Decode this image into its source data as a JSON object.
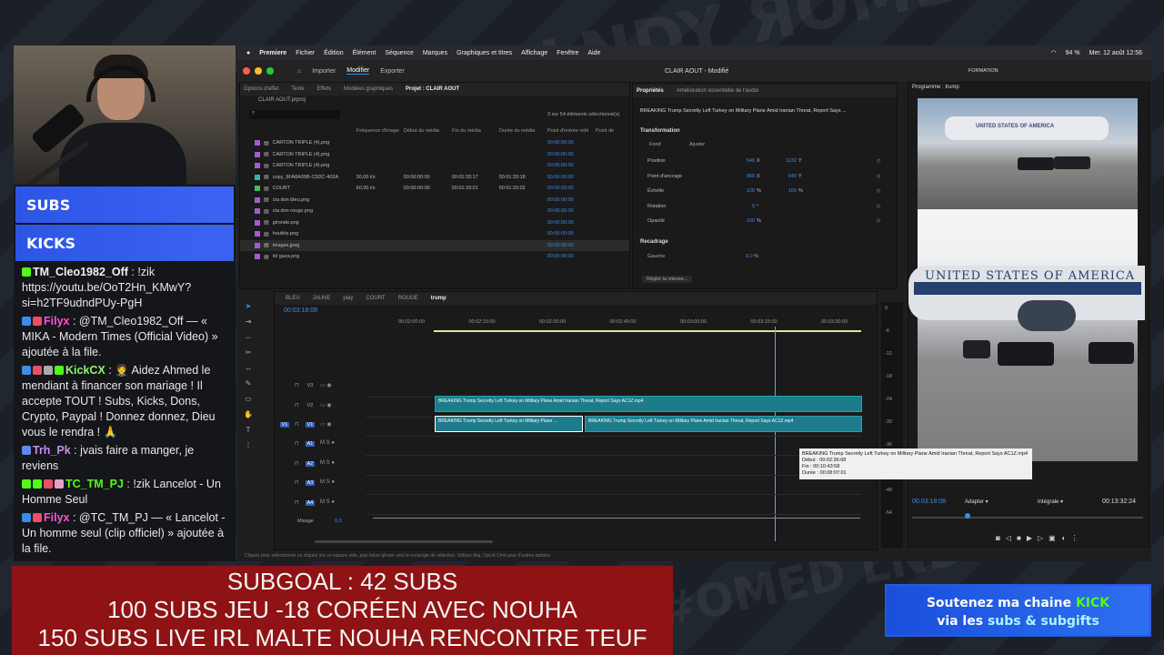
{
  "premiere": {
    "menubar": [
      "Premiere",
      "Fichier",
      "Édition",
      "Élément",
      "Séquence",
      "Marques",
      "Graphiques et titres",
      "Affichage",
      "Fenêtre",
      "Aide"
    ],
    "clock": "Mer. 12 août 12:56",
    "battery": "94 %",
    "workspaces": [
      "Importer",
      "Modifier",
      "Exporter"
    ],
    "doc_title": "CLAIR AOUT - Modifié",
    "formation": "FORMATION",
    "project_tabs": [
      "Options d'effet",
      "Texte",
      "Effets",
      "Modèles graphiques",
      "Projet : CLAIR AOUT"
    ],
    "project_file": "CLAIR AOUT.prproj",
    "selection_count": "3 sur 54 éléments sélectionné(s)",
    "columns": [
      "Fréquence d'image",
      "Début du média",
      "Fin du média",
      "Durée du média",
      "Point d'entrée vidé",
      "Point de"
    ],
    "items": [
      {
        "name": "CARTON TRIPLE (4).png",
        "fps": "",
        "start": "",
        "end": "",
        "dur": "",
        "in": "00:00:00:00",
        "color": "#a45bd0"
      },
      {
        "name": "CARTON TRIPLE (4).png",
        "fps": "",
        "start": "",
        "end": "",
        "dur": "",
        "in": "00:00:00:00",
        "color": "#a45bd0"
      },
      {
        "name": "CARTON TRIPLE (4).png",
        "fps": "",
        "start": "",
        "end": "",
        "dur": "",
        "in": "00:00:00:00",
        "color": "#a45bd0"
      },
      {
        "name": "copy_9FA8A09B-C5DC-402A",
        "fps": "30,00 i/s",
        "start": "00:00:00:00",
        "end": "00:01:33:17",
        "dur": "00:01:33:18",
        "in": "00:00:00:00",
        "color": "#2fb8a8"
      },
      {
        "name": "COURT",
        "fps": "60,00 i/s",
        "start": "00:00:00:00",
        "end": "00:01:33:01",
        "dur": "00:01:33:02",
        "in": "00:00:00:00",
        "color": "#3fbf55"
      },
      {
        "name": "cta don bleu.png",
        "fps": "",
        "start": "",
        "end": "",
        "dur": "",
        "in": "00:00:00:00",
        "color": "#a45bd0"
      },
      {
        "name": "cta don rouge.png",
        "fps": "",
        "start": "",
        "end": "",
        "dur": "",
        "in": "00:00:00:00",
        "color": "#a45bd0"
      },
      {
        "name": "gironde.png",
        "fps": "",
        "start": "",
        "end": "",
        "dur": "",
        "in": "00:00:00:00",
        "color": "#a45bd0"
      },
      {
        "name": "houthis.png",
        "fps": "",
        "start": "",
        "end": "",
        "dur": "",
        "in": "00:00:00:00",
        "color": "#a45bd0"
      },
      {
        "name": "images.jpeg",
        "fps": "",
        "start": "",
        "end": "",
        "dur": "",
        "in": "00:00:00:00",
        "color": "#a45bd0"
      },
      {
        "name": "lol gaza.png",
        "fps": "",
        "start": "",
        "end": "",
        "dur": "",
        "in": "00:00:00:00",
        "color": "#a45bd0"
      }
    ],
    "props_tabs": [
      "Propriétés",
      "Amélioration essentielle de l'audio"
    ],
    "props_clip": "BREAKING Trump Secretly Left Turkey on Military Plane Amid Iranian Threat, Report Says ...",
    "transformation": "Transformation",
    "fond": "Fond",
    "ajuster": "Ajuster",
    "props": [
      {
        "label": "Position",
        "v1": "540",
        "u1": "X",
        "v2": "1232",
        "u2": "Y"
      },
      {
        "label": "Point d'ancrage",
        "v1": "960",
        "u1": "X",
        "v2": "540",
        "u2": "Y"
      },
      {
        "label": "Échelle",
        "v1": "128",
        "u1": "%",
        "v2": "100",
        "u2": "%"
      },
      {
        "label": "Rotation",
        "v1": "0",
        "u1": "°",
        "v2": "",
        "u2": ""
      },
      {
        "label": "Opacité",
        "v1": "100",
        "u1": "%",
        "v2": "",
        "u2": ""
      }
    ],
    "recadrage": "Recadrage",
    "gauche": "Gauche",
    "gauche_val": "0,0",
    "gauche_unit": "%",
    "regler": "Régler la vitesse...",
    "seq_tabs": [
      "BLEU",
      "JAUNE",
      "play",
      "COURT",
      "ROUGE",
      "trump"
    ],
    "timecode": "00:03:18:08",
    "ruler": [
      "00:02:00:00",
      "00:02:15:00",
      "00:02:30:00",
      "00:02:45:00",
      "00:03:00:00",
      "00:03:15:00",
      "00:03:30:00"
    ],
    "tracks_v": [
      "V3",
      "V2",
      "V1"
    ],
    "tracks_a": [
      "A1",
      "A2",
      "A3",
      "A4"
    ],
    "mixage": "Mixage",
    "mixage_val": "0,0",
    "clip_title": "BREAKING Trump Secretly Left Turkey on Military Plane Amid Iranian Threat, Report Says  AC1Z.mp4",
    "clip_short": "BREAKING Trump Secretly Left Turkey on Military Plane ...",
    "tooltip": [
      "BREAKING Trump Secretly Left Turkey on Military Plane Amid Iranian Threat, Report Says  AC1Z.mp4",
      "Début : 00:02:36:68",
      "Fin : 00:10:43:58",
      "Durée : 00:08:07:01"
    ],
    "status": "Cliquez pour sélectionner ou cliquez sur un espace vide, puis faites glisser vers le rectangle de sélection. Utilisez Maj, Opt et Cmd pour d'autres options.",
    "program_tab": "Programme : trump",
    "prog_time": "00:03:18:08",
    "prog_fit": "Adapter",
    "prog_quality": "Intégrale",
    "prog_dur": "00:13:32:24",
    "audio_scale": [
      "0",
      "-6",
      "-12",
      "-18",
      "-24",
      "-30",
      "-36",
      "-42",
      "-48",
      "-54"
    ]
  },
  "chat": {
    "subs_label": "SUBS",
    "kicks_label": "KICKS",
    "messages": [
      {
        "user": "TM_Cleo1982_Off",
        "ucolor": "#f2f2f2",
        "sep": " : ",
        "text": "!zik https://youtu.be/OoT2Hn_KMwY?si=h2TF9udndPUy-PgH",
        "b": [
          "#53fc18"
        ]
      },
      {
        "user": "Filyx",
        "ucolor": "#ff4fd8",
        "sep": " : ",
        "text": "@TM_Cleo1982_Off — « MIKA - Modern Times (Official Video) » ajoutée à la file.",
        "b": [
          "#3a8ce8",
          "#e8506a"
        ]
      },
      {
        "user": "KickCX",
        "ucolor": "#8ef56b",
        "sep": " : ",
        "text": "🤵 Aidez Ahmed le mendiant à financer son mariage ! Il accepte TOUT ! Subs, Kicks, Dons, Crypto, Paypal ! Donnez donnez, Dieu vous le rendra ! 🙏",
        "b": [
          "#3a8ce8",
          "#e8506a",
          "#aaa",
          "#53fc18"
        ]
      },
      {
        "user": "Trh_Pk",
        "ucolor": "#c98af0",
        "sep": " : ",
        "text": "jvais faire a manger, je reviens",
        "b": [
          "#5a8cf0"
        ]
      },
      {
        "user": "TC_TM_PJ",
        "ucolor": "#53fc18",
        "sep": " : ",
        "text": "!zik Lancelot - Un Homme Seul",
        "b": [
          "#53fc18",
          "#53fc18",
          "#e8506a",
          "#e8a0c8"
        ]
      },
      {
        "user": "Filyx",
        "ucolor": "#ff4fd8",
        "sep": " : ",
        "text": "@TC_TM_PJ — « Lancelot - Un homme seul (clip officiel) » ajoutée à la file.",
        "b": [
          "#3a8ce8",
          "#e8506a"
        ]
      }
    ]
  },
  "subgoal": {
    "lines": [
      "SUBGOAL : 42 SUBS",
      "100 SUBS JEU -18 CORÉEN AVEC NOUHA",
      "150 SUBS LIVE IRL MALTE NOUHA RENCONTRE TEUF"
    ]
  },
  "kick_banner": {
    "line1_pre": "Soutenez ma chaine ",
    "line1_brand": "KICK",
    "line2_pre": "via les ",
    "line2_accent": "subs & subgifts"
  },
  "video_scene": {
    "airplane_text": "UNITED STATES OF AMERICA"
  }
}
